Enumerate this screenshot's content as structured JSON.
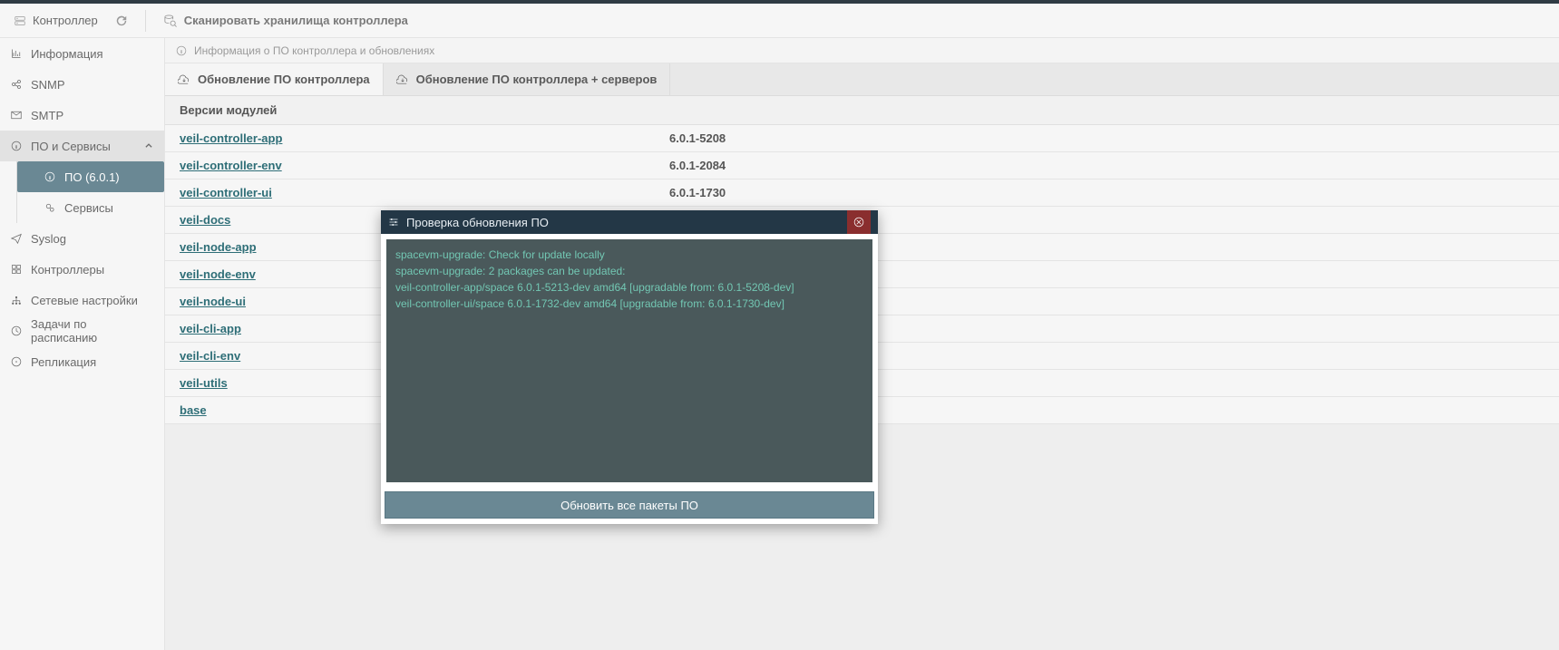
{
  "toolbar": {
    "controller_label": "Контроллер",
    "scan_label": "Сканировать хранилища контроллера"
  },
  "sidebar": {
    "items": [
      {
        "label": "Информация"
      },
      {
        "label": "SNMP"
      },
      {
        "label": "SMTP"
      },
      {
        "label": "ПО и Сервисы",
        "open": true,
        "subs": [
          {
            "label": "ПО (6.0.1)",
            "active": true
          },
          {
            "label": "Сервисы"
          }
        ]
      },
      {
        "label": "Syslog"
      },
      {
        "label": "Контроллеры"
      },
      {
        "label": "Сетевые настройки"
      },
      {
        "label": "Задачи по расписанию"
      },
      {
        "label": "Репликация"
      }
    ]
  },
  "page": {
    "info": "Информация о ПО контроллера и обновлениях",
    "tabs": [
      "Обновление ПО контроллера",
      "Обновление ПО контроллера + серверов"
    ],
    "section_title": "Версии модулей",
    "modules": [
      {
        "name": "veil-controller-app",
        "version": "6.0.1-5208"
      },
      {
        "name": "veil-controller-env",
        "version": "6.0.1-2084"
      },
      {
        "name": "veil-controller-ui",
        "version": "6.0.1-1730"
      },
      {
        "name": "veil-docs",
        "version": ""
      },
      {
        "name": "veil-node-app",
        "version": ""
      },
      {
        "name": "veil-node-env",
        "version": ""
      },
      {
        "name": "veil-node-ui",
        "version": ""
      },
      {
        "name": "veil-cli-app",
        "version": ""
      },
      {
        "name": "veil-cli-env",
        "version": ""
      },
      {
        "name": "veil-utils",
        "version": ""
      },
      {
        "name": "base",
        "version": ""
      }
    ]
  },
  "modal": {
    "title": "Проверка обновления ПО",
    "lines": [
      "spacevm-upgrade: Check for update locally",
      "spacevm-upgrade: 2 packages can be updated:",
      "veil-controller-app/space 6.0.1-5213-dev amd64 [upgradable from: 6.0.1-5208-dev]",
      "veil-controller-ui/space 6.0.1-1732-dev amd64 [upgradable from: 6.0.1-1730-dev]"
    ],
    "action": "Обновить все пакеты ПО"
  }
}
